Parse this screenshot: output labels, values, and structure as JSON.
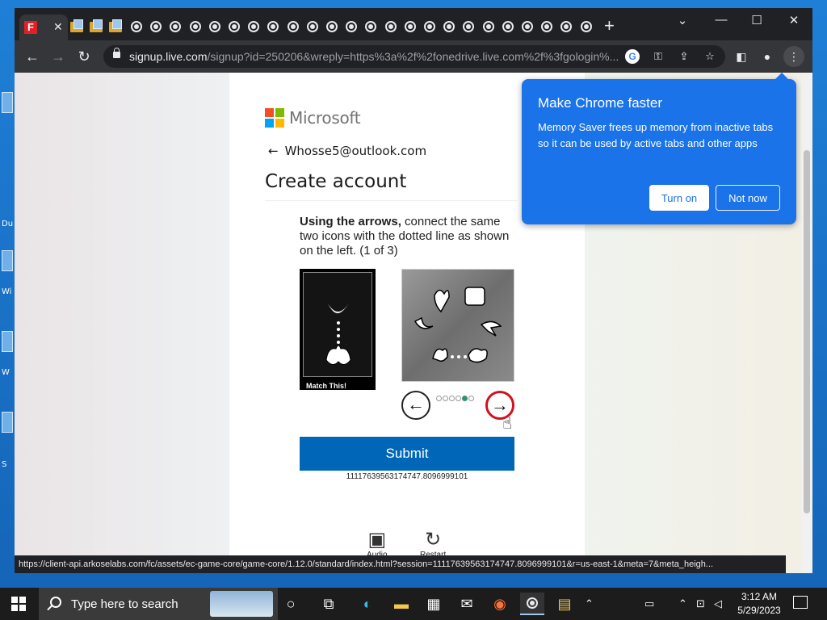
{
  "browser": {
    "tab_close": "✕",
    "new_tab": "+",
    "url_host": "signup.live.com",
    "url_path": "/signup?id=250206&wreply=https%3a%2f%2fonedrive.live.com%2f%3fgologin%...",
    "status_url": "https://client-api.arkoselabs.com/fc/assets/ec-game-core/game-core/1.12.0/standard/index.html?session=11117639563174747.8096999101&r=us-east-1&meta=7&meta_heigh..."
  },
  "page": {
    "brand": "Microsoft",
    "email": "Whosse5@outlook.com",
    "title": "Create account",
    "instruction_bold": "Using the arrows,",
    "instruction_rest": " connect the same two icons with the dotted line as shown on the left. (1 of 3)",
    "match_label": "Match This!",
    "submit_label": "Submit",
    "session_id": "11117639563174747.8096999101",
    "audio_label": "Audio",
    "restart_label": "Restart",
    "progress": {
      "total": 6,
      "active_index": 4
    }
  },
  "popup": {
    "title": "Make Chrome faster",
    "body": "Memory Saver frees up memory from inactive tabs so it can be used by active tabs and other apps",
    "turn_on": "Turn on",
    "not_now": "Not now"
  },
  "taskbar": {
    "search_placeholder": "Type here to search",
    "time": "3:12 AM",
    "date": "5/29/2023"
  },
  "desktop": {
    "labels": [
      "Du",
      "Wi",
      "W",
      "S"
    ]
  },
  "colors": {
    "accent": "#0067b8",
    "popup": "#1a73e8",
    "active_arrow": "#d0121f",
    "active_dot": "#3a8f70"
  }
}
